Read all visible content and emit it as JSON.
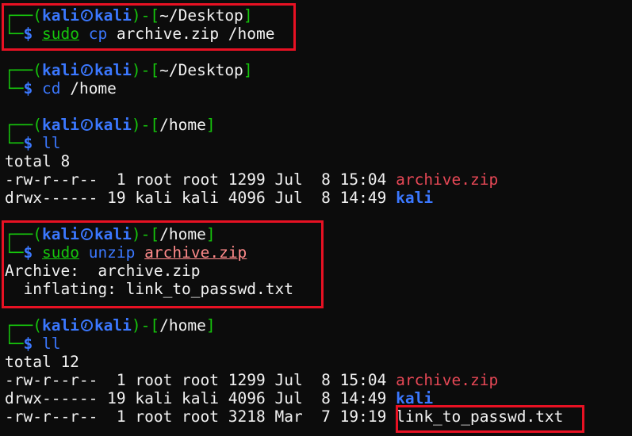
{
  "prompt": {
    "top_left": "┌──(",
    "bottom_left": "└─",
    "user": "kali",
    "host": "kali",
    "dir_sep_open": ")-[",
    "dir_sep_close": "]",
    "dollar": "$"
  },
  "blocks": [
    {
      "dir": "~/Desktop",
      "cmd": [
        {
          "t": "sudo",
          "c": "g u"
        },
        {
          "t": " ",
          "c": "w"
        },
        {
          "t": "cp",
          "c": "b"
        },
        {
          "t": " archive.zip /home",
          "c": "w"
        }
      ]
    },
    {
      "dir": "~/Desktop",
      "cmd": [
        {
          "t": "cd",
          "c": "b"
        },
        {
          "t": " /home",
          "c": "w"
        }
      ]
    },
    {
      "dir": "/home",
      "cmd": [
        {
          "t": "ll",
          "c": "b"
        }
      ]
    },
    {
      "dir": "/home",
      "cmd": [
        {
          "t": "sudo",
          "c": "g u"
        },
        {
          "t": " ",
          "c": "w"
        },
        {
          "t": "unzip",
          "c": "b"
        },
        {
          "t": " ",
          "c": "w"
        },
        {
          "t": "archive.zip",
          "c": "sa u"
        }
      ]
    },
    {
      "dir": "/home",
      "cmd": [
        {
          "t": "ll",
          "c": "b"
        }
      ]
    }
  ],
  "outputs": {
    "ll1": [
      {
        "text": "total 8"
      },
      {
        "text": "-rw-r--r--  1 root root 1299 Jul  8 15:04 ",
        "name": "archive.zip",
        "color": "r"
      },
      {
        "text": "drwx------ 19 kali kali 4096 Jul  8 14:49 ",
        "name": "kali",
        "color": "bb"
      }
    ],
    "unzip": [
      {
        "text": "Archive:  archive.zip"
      },
      {
        "text": "  inflating: link_to_passwd.txt"
      }
    ],
    "ll2": [
      {
        "text": "total 12"
      },
      {
        "text": "-rw-r--r--  1 root root 1299 Jul  8 15:04 ",
        "name": "archive.zip",
        "color": "r"
      },
      {
        "text": "drwx------ 19 kali kali 4096 Jul  8 14:49 ",
        "name": "kali",
        "color": "bb"
      },
      {
        "text": "-rw-r--r--  1 root root 3218 Mar  7 19:19 ",
        "name": "link_to_passwd.txt",
        "color": "w"
      }
    ]
  },
  "colors": {
    "background": "#0c0c0c",
    "prompt_green": "#16c60c",
    "prompt_blue": "#3b78ff",
    "file_red": "#e74856",
    "highlight_box": "#e81123"
  }
}
